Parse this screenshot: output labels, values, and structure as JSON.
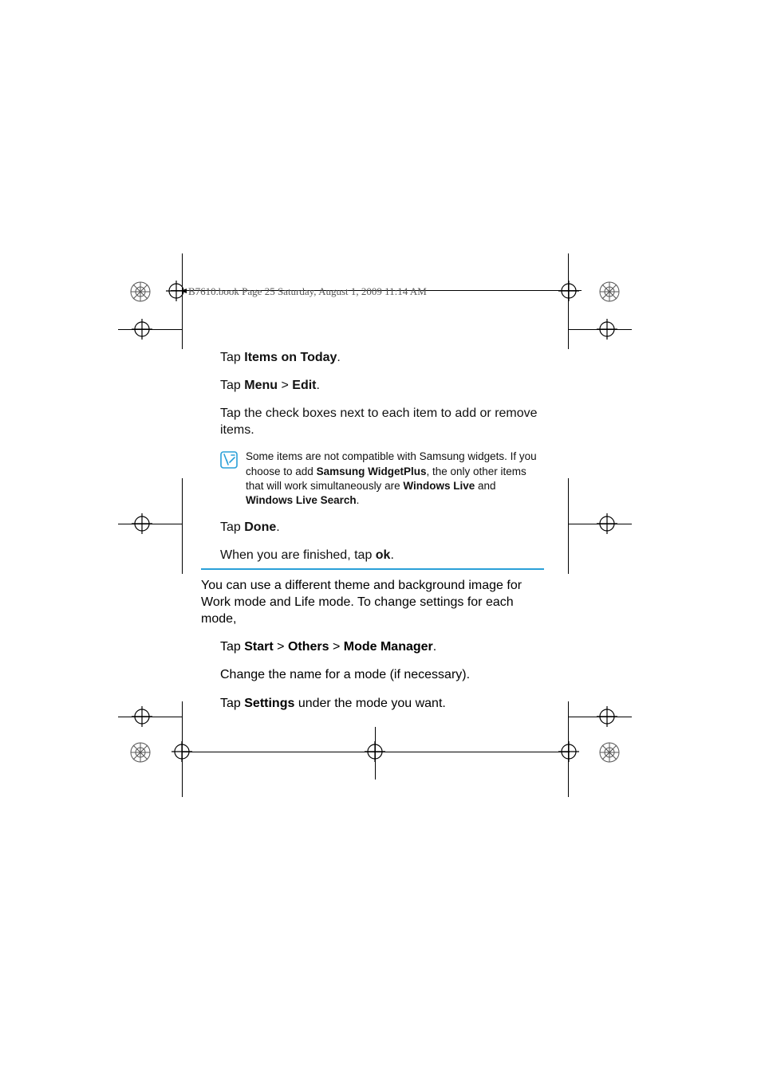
{
  "header": {
    "line": "B7610.book  Page 25  Saturday, August 1, 2009  11:14 AM"
  },
  "block1": {
    "s1_pre": "Tap ",
    "s1_b1": "Items on Today",
    "s1_post": ".",
    "s2_pre": "Tap ",
    "s2_b1": "Menu",
    "s2_mid": " > ",
    "s2_b2": "Edit",
    "s2_post": ".",
    "s3": "Tap the check boxes next to each item to add or remove items.",
    "note_t1": "Some items are not compatible with Samsung widgets. If you choose to add ",
    "note_b1": "Samsung WidgetPlus",
    "note_t2": ", the only other items that will work simultaneously are ",
    "note_b2": "Windows Live",
    "note_t3": " and ",
    "note_b3": "Windows Live Search",
    "note_t4": ".",
    "s4_pre": "Tap ",
    "s4_b1": "Done",
    "s4_post": ".",
    "s5_pre": "When you are finished, tap ",
    "s5_b1": "ok",
    "s5_post": "."
  },
  "block2": {
    "intro": "You can use a different theme and background image for Work mode and Life mode. To change settings for each mode,",
    "s1_pre": "Tap ",
    "s1_b1": "Start",
    "s1_m1": " > ",
    "s1_b2": "Others",
    "s1_m2": " > ",
    "s1_b3": "Mode Manager",
    "s1_post": ".",
    "s2": "Change the name for a mode (if necessary).",
    "s3_pre": "Tap ",
    "s3_b1": "Settings",
    "s3_post": " under the mode you want."
  }
}
